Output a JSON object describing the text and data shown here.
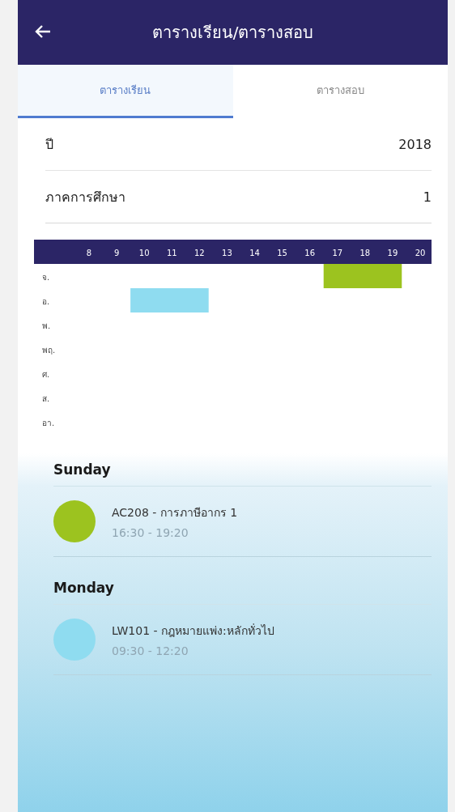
{
  "app_bar": {
    "title": "ตารางเรียน/ตารางสอบ"
  },
  "tabs": [
    {
      "label": "ตารางเรียน",
      "selected": true
    },
    {
      "label": "ตารางสอบ",
      "selected": false
    }
  ],
  "fields": [
    {
      "label": "ปี",
      "value": "2018"
    },
    {
      "label": "ภาคการศึกษา",
      "value": "1"
    }
  ],
  "timetable": {
    "hours": [
      "8",
      "9",
      "10",
      "11",
      "12",
      "13",
      "14",
      "15",
      "16",
      "17",
      "18",
      "19",
      "20"
    ],
    "day_labels": [
      "จ.",
      "อ.",
      "พ.",
      "พฤ.",
      "ศ.",
      "ส.",
      "อา."
    ]
  },
  "days": [
    {
      "name": "Sunday",
      "classes": [
        {
          "title": "AC208 - การภาษีอากร 1",
          "time": "16:30 - 19:20",
          "color": "#9cc31f"
        }
      ]
    },
    {
      "name": "Monday",
      "classes": [
        {
          "title": "LW101 - กฎหมายแพ่ง:หลักทั่วไป",
          "time": "09:30 - 12:20",
          "color": "#8fdcf0"
        }
      ]
    }
  ]
}
